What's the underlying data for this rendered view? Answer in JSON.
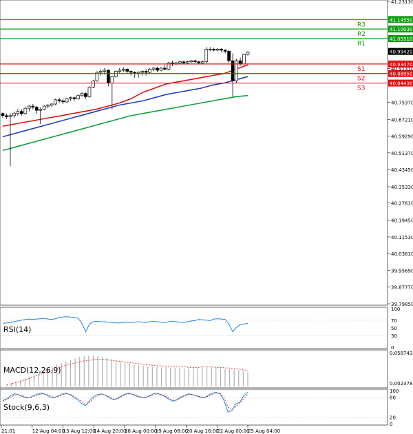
{
  "chart_data": [
    {
      "type": "candlestick",
      "ylim": [
        39.7985,
        41.2313
      ],
      "y_ticks": [
        "41.23130",
        "41.14550",
        "41.10030",
        "41.05510",
        "40.99420",
        "40.93470",
        "40.91310",
        "40.88950",
        "40.84430",
        "40.75370",
        "40.67210",
        "40.59290",
        "40.51370",
        "40.43450",
        "40.35330",
        "40.27610",
        "40.19450",
        "40.11530",
        "40.03610",
        "39.95690",
        "39.87770",
        "39.79850"
      ],
      "x_ticks": [
        "21:01",
        "12 Aug 04:00",
        "13 Aug 12:00",
        "14 Aug 20:00",
        "18 Aug 00:00",
        "19 Aug 08:00",
        "20 Aug 16:00",
        "22 Aug 00:00",
        "25 Aug 04:00"
      ],
      "last_price": "40.99420",
      "levels": [
        {
          "label": "R3",
          "value": 41.1455,
          "price_label": "41.14550",
          "color": "#10a010"
        },
        {
          "label": "R2",
          "value": 41.1003,
          "price_label": "41.10030",
          "color": "#10a010"
        },
        {
          "label": "R1",
          "value": 41.0551,
          "price_label": "41.05510",
          "color": "#10a010"
        },
        {
          "label": "S1",
          "value": 40.9347,
          "price_label": "40.93470",
          "color": "#e01010"
        },
        {
          "label": "S2",
          "value": 40.8895,
          "price_label": "40.88950",
          "color": "#e01010"
        },
        {
          "label": "S3",
          "value": 40.8443,
          "price_label": "40.84430",
          "color": "#e01010"
        }
      ],
      "candles": [
        [
          40.7,
          40.705,
          40.68,
          40.69
        ],
        [
          40.69,
          40.7,
          40.675,
          40.685
        ],
        [
          40.685,
          40.7,
          40.45,
          40.69
        ],
        [
          40.69,
          40.71,
          40.68,
          40.7
        ],
        [
          40.7,
          40.72,
          40.69,
          40.71
        ],
        [
          40.71,
          40.72,
          40.69,
          40.7
        ],
        [
          40.7,
          40.73,
          40.695,
          40.725
        ],
        [
          40.725,
          40.74,
          40.71,
          40.735
        ],
        [
          40.735,
          40.745,
          40.72,
          40.73
        ],
        [
          40.73,
          40.735,
          40.7,
          40.715
        ],
        [
          40.715,
          40.73,
          40.65,
          40.72
        ],
        [
          40.72,
          40.74,
          40.715,
          40.735
        ],
        [
          40.735,
          40.745,
          40.725,
          40.74
        ],
        [
          40.74,
          40.75,
          40.73,
          40.745
        ],
        [
          40.745,
          40.77,
          40.74,
          40.765
        ],
        [
          40.765,
          40.775,
          40.75,
          40.76
        ],
        [
          40.76,
          40.77,
          40.745,
          40.755
        ],
        [
          40.755,
          40.775,
          40.75,
          40.77
        ],
        [
          40.77,
          40.78,
          40.76,
          40.775
        ],
        [
          40.775,
          40.78,
          40.76,
          40.77
        ],
        [
          40.77,
          40.79,
          40.765,
          40.785
        ],
        [
          40.785,
          40.8,
          40.78,
          40.795
        ],
        [
          40.795,
          40.8,
          40.77,
          40.78
        ],
        [
          40.78,
          40.83,
          40.775,
          40.825
        ],
        [
          40.825,
          40.86,
          40.82,
          40.855
        ],
        [
          40.855,
          40.9,
          40.85,
          40.895
        ],
        [
          40.895,
          40.91,
          40.88,
          40.9
        ],
        [
          40.9,
          40.915,
          40.885,
          40.905
        ],
        [
          40.905,
          40.91,
          40.83,
          40.845
        ],
        [
          40.845,
          40.88,
          40.72,
          40.875
        ],
        [
          40.875,
          40.905,
          40.87,
          40.9
        ],
        [
          40.9,
          40.915,
          40.89,
          40.905
        ],
        [
          40.905,
          40.92,
          40.895,
          40.91
        ],
        [
          40.91,
          40.915,
          40.89,
          40.9
        ],
        [
          40.9,
          40.905,
          40.88,
          40.895
        ],
        [
          40.895,
          40.9,
          40.87,
          40.89
        ],
        [
          40.89,
          40.9,
          40.87,
          40.895
        ],
        [
          40.895,
          40.905,
          40.88,
          40.9
        ],
        [
          40.9,
          40.91,
          40.88,
          40.895
        ],
        [
          40.895,
          40.915,
          40.89,
          40.91
        ],
        [
          40.91,
          40.92,
          40.9,
          40.915
        ],
        [
          40.915,
          40.92,
          40.895,
          40.905
        ],
        [
          40.905,
          40.92,
          40.9,
          40.915
        ],
        [
          40.915,
          40.93,
          40.905,
          40.91
        ],
        [
          40.91,
          40.945,
          40.905,
          40.94
        ],
        [
          40.94,
          40.95,
          40.925,
          40.935
        ],
        [
          40.935,
          40.945,
          40.93,
          40.94
        ],
        [
          40.94,
          40.95,
          40.935,
          40.945
        ],
        [
          40.945,
          40.95,
          40.935,
          40.94
        ],
        [
          40.94,
          40.95,
          40.935,
          40.945
        ],
        [
          40.945,
          40.955,
          40.94,
          40.95
        ],
        [
          40.95,
          40.955,
          40.94,
          40.945
        ],
        [
          40.945,
          40.95,
          40.935,
          40.94
        ],
        [
          40.94,
          40.95,
          40.935,
          40.945
        ],
        [
          40.945,
          41.015,
          40.94,
          41.005
        ],
        [
          41.005,
          41.015,
          40.995,
          41.005
        ],
        [
          41.005,
          41.012,
          40.995,
          41.0
        ],
        [
          41.0,
          41.01,
          40.995,
          41.005
        ],
        [
          41.005,
          41.01,
          40.99,
          41.0
        ],
        [
          41.0,
          41.005,
          40.985,
          40.995
        ],
        [
          40.995,
          41.0,
          40.94,
          40.95
        ],
        [
          40.95,
          40.985,
          40.78,
          40.855
        ],
        [
          40.855,
          40.96,
          40.845,
          40.95
        ],
        [
          40.95,
          40.965,
          40.925,
          40.935
        ],
        [
          40.935,
          40.985,
          40.93,
          40.98
        ],
        [
          40.98,
          40.995,
          40.975,
          40.99
        ]
      ],
      "series": [
        {
          "color": "#e01010",
          "values": [
            40.64,
            40.65,
            40.66,
            40.67,
            40.68,
            40.69,
            40.7,
            40.71,
            40.72,
            40.735,
            40.75,
            40.77,
            40.8,
            40.82,
            40.84,
            40.85,
            40.86,
            40.87,
            40.88,
            40.89,
            40.91,
            40.93
          ]
        },
        {
          "color": "#2040c0",
          "values": [
            40.59,
            40.605,
            40.62,
            40.635,
            40.65,
            40.665,
            40.68,
            40.695,
            40.71,
            40.725,
            40.74,
            40.75,
            40.76,
            40.775,
            40.79,
            40.8,
            40.81,
            40.82,
            40.835,
            40.845,
            40.86,
            40.875
          ]
        },
        {
          "color": "#10a040",
          "values": [
            40.525,
            40.54,
            40.555,
            40.57,
            40.585,
            40.6,
            40.615,
            40.63,
            40.645,
            40.66,
            40.675,
            40.69,
            40.7,
            40.71,
            40.72,
            40.73,
            40.74,
            40.75,
            40.76,
            40.77,
            40.78,
            40.785
          ]
        }
      ]
    },
    {
      "type": "line",
      "title": "RSI(14)",
      "y_ticks": [
        "100",
        "70",
        "50",
        "30",
        "0"
      ],
      "ylim": [
        0,
        100
      ],
      "values": [
        62,
        63,
        64,
        66,
        68,
        70,
        72,
        73,
        72,
        73,
        74,
        75,
        73,
        72,
        74,
        77,
        78,
        79,
        78,
        77,
        75,
        62,
        40,
        60,
        66,
        67,
        66,
        66,
        65,
        64,
        63,
        63,
        64,
        65,
        64,
        65,
        66,
        65,
        64,
        66,
        67,
        66,
        65,
        64,
        66,
        67,
        66,
        65,
        64,
        66,
        68,
        69,
        72,
        71,
        70,
        69,
        73,
        74,
        73,
        72,
        60,
        40,
        52,
        58,
        60,
        62
      ]
    },
    {
      "type": "bar",
      "title": "MACD(12,26,9)",
      "y_ticks": [
        "0.058743",
        "0.002378"
      ],
      "ylim": [
        0,
        0.062
      ],
      "bars": [
        0.004,
        0.006,
        0.009,
        0.012,
        0.015,
        0.018,
        0.021,
        0.024,
        0.028,
        0.032,
        0.036,
        0.04,
        0.043,
        0.046,
        0.049,
        0.052,
        0.054,
        0.056,
        0.057,
        0.057,
        0.056,
        0.054,
        0.052,
        0.05,
        0.048,
        0.046,
        0.044,
        0.042,
        0.04,
        0.039,
        0.038,
        0.037,
        0.036,
        0.036,
        0.035,
        0.035,
        0.034,
        0.034,
        0.034,
        0.033,
        0.033,
        0.034,
        0.035,
        0.036,
        0.036,
        0.035,
        0.034,
        0.033,
        0.032,
        0.032,
        0.031,
        0.03,
        0.028,
        0.026
      ],
      "signal": [
        0.003,
        0.005,
        0.007,
        0.009,
        0.012,
        0.015,
        0.018,
        0.021,
        0.024,
        0.027,
        0.03,
        0.033,
        0.036,
        0.039,
        0.041,
        0.043,
        0.045,
        0.047,
        0.048,
        0.049,
        0.05,
        0.05,
        0.049,
        0.048,
        0.047,
        0.046,
        0.045,
        0.044,
        0.043,
        0.042,
        0.041,
        0.04,
        0.039,
        0.038,
        0.038,
        0.037,
        0.037,
        0.036,
        0.036,
        0.036,
        0.035,
        0.035,
        0.035,
        0.036,
        0.036,
        0.036,
        0.035,
        0.035,
        0.034,
        0.034,
        0.033,
        0.032,
        0.031,
        0.029
      ]
    },
    {
      "type": "line",
      "title": "Stock(9,6,3)",
      "y_ticks": [
        "100",
        "80",
        "20",
        "0"
      ],
      "ylim": [
        0,
        100
      ],
      "k": [
        70,
        75,
        85,
        90,
        88,
        82,
        78,
        80,
        86,
        90,
        92,
        88,
        80,
        78,
        84,
        90,
        92,
        88,
        80,
        72,
        60,
        55,
        70,
        82,
        88,
        90,
        86,
        78,
        72,
        76,
        84,
        90,
        92,
        88,
        82,
        80,
        78,
        84,
        90,
        92,
        88,
        82,
        74,
        68,
        72,
        80,
        86,
        90,
        88,
        84,
        80,
        78,
        86,
        92,
        95,
        90,
        70,
        35,
        40,
        60,
        65,
        85,
        95
      ],
      "d": [
        68,
        72,
        80,
        86,
        88,
        85,
        80,
        79,
        83,
        88,
        90,
        89,
        84,
        80,
        82,
        87,
        90,
        89,
        84,
        77,
        66,
        58,
        64,
        76,
        85,
        88,
        87,
        81,
        75,
        75,
        81,
        87,
        90,
        89,
        85,
        81,
        79,
        82,
        87,
        90,
        89,
        84,
        77,
        71,
        71,
        77,
        83,
        88,
        88,
        85,
        82,
        79,
        83,
        89,
        93,
        91,
        79,
        50,
        42,
        52,
        62,
        76,
        88
      ]
    }
  ]
}
